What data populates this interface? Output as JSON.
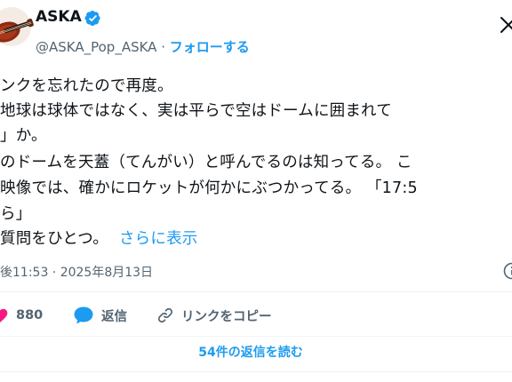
{
  "author": {
    "display_name": "ASKA",
    "handle": "@ASKA_Pop_ASKA",
    "separator": " · ",
    "follow_label": "フォローする"
  },
  "tweet": {
    "lines": [
      "ンクを忘れたので再度。",
      "地球は球体ではなく、実は平らで空はドーム​に囲まれて",
      "」か。",
      "のドームを天蓋（てんがい）と呼んでるのは知ってる。 こ",
      "映像では、確かにロケットが何かにぶつかってる。 「17:5",
      "ら」",
      "質問をひとつ。"
    ],
    "see_more": "さらに表示",
    "timestamp": "後11:53 · 2025年8月13日"
  },
  "actions": {
    "likes": "880",
    "reply_label": "返信",
    "copy_link_label": "リンクをコピー"
  },
  "read_replies_label": "54件の返信を読む",
  "colors": {
    "accent": "#1d9bf0",
    "like": "#f91880",
    "secondary_text": "#536471",
    "text": "#0f1419",
    "divider": "#eff3f4"
  },
  "icons": [
    "violin-avatar",
    "verified-badge-icon",
    "more-icon",
    "info-icon",
    "heart-icon",
    "reply-bubble-icon",
    "link-icon"
  ]
}
